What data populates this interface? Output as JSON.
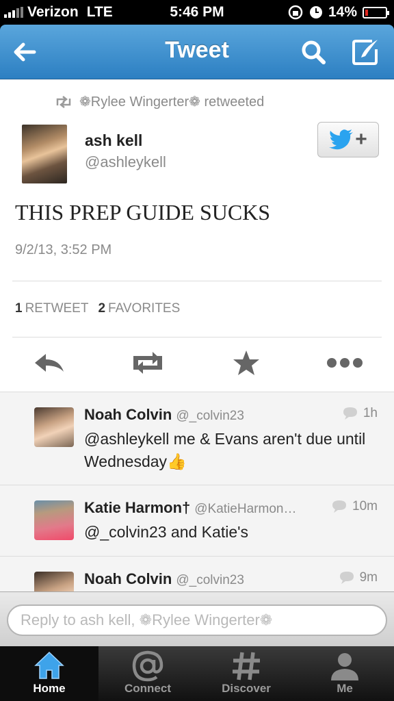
{
  "status_bar": {
    "carrier": "Verizon",
    "network": "LTE",
    "time": "5:46 PM",
    "battery": "14%",
    "battery_level": 0.14
  },
  "nav": {
    "title": "Tweet",
    "back_icon": "back-arrow-icon",
    "search_icon": "search-icon",
    "compose_icon": "compose-icon"
  },
  "tweet": {
    "retweeted_by": "❁Rylee Wingerter❁ retweeted",
    "author_name": "ash kell",
    "author_handle": "@ashleykell",
    "text": "THIS PREP GUIDE SUCKS",
    "date": "9/2/13, 3:52 PM",
    "retweet_count": "1",
    "retweet_label": "RETWEET",
    "favorite_count": "2",
    "favorite_label": "FAVORITES"
  },
  "replies": [
    {
      "name": "Noah Colvin",
      "handle": "@_colvin23",
      "time": "1h",
      "text": "@ashleykell me & Evans aren't due until Wednesday👍"
    },
    {
      "name": "Katie Harmon†",
      "handle": "@KatieHarmon…",
      "time": "10m",
      "text": "@_colvin23 and Katie's"
    },
    {
      "name": "Noah Colvin",
      "handle": "@_colvin23",
      "time": "9m",
      "text": ""
    }
  ],
  "reply_bar": {
    "placeholder": "Reply to ash kell, ❁Rylee Wingerter❁"
  },
  "tabs": [
    {
      "label": "Home",
      "icon": "home-icon",
      "active": true
    },
    {
      "label": "Connect",
      "icon": "at-icon",
      "active": false
    },
    {
      "label": "Discover",
      "icon": "hash-icon",
      "active": false
    },
    {
      "label": "Me",
      "icon": "person-icon",
      "active": false
    }
  ],
  "colors": {
    "nav_blue": "#3a8fd0",
    "twitter_blue": "#2aa3ef"
  }
}
